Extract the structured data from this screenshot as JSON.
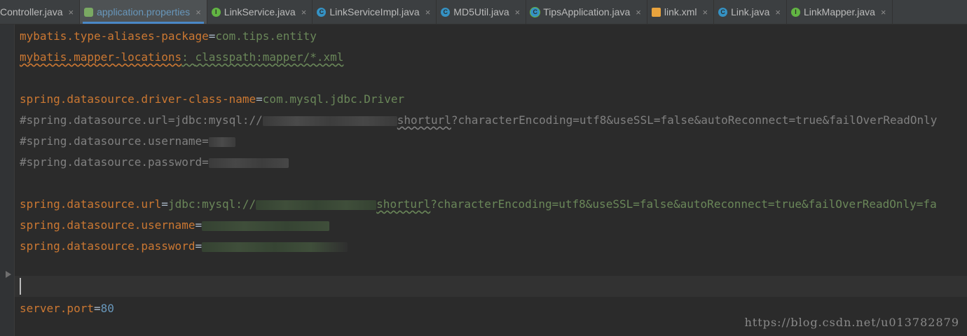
{
  "tabs": [
    {
      "label": "Controller.java",
      "icon": "class-icon",
      "active": false
    },
    {
      "label": "application.properties",
      "icon": "properties-icon",
      "active": true
    },
    {
      "label": "LinkService.java",
      "icon": "interface-icon",
      "active": false
    },
    {
      "label": "LinkServiceImpl.java",
      "icon": "class-icon",
      "active": false
    },
    {
      "label": "MD5Util.java",
      "icon": "class-icon",
      "active": false
    },
    {
      "label": "TipsApplication.java",
      "icon": "spring-app-icon",
      "active": false
    },
    {
      "label": "link.xml",
      "icon": "xml-icon",
      "active": false
    },
    {
      "label": "Link.java",
      "icon": "class-icon",
      "active": false
    },
    {
      "label": "LinkMapper.java",
      "icon": "interface-icon",
      "active": false
    }
  ],
  "close_glyph": "×",
  "code": {
    "l1": {
      "key": "mybatis.type-aliases-package",
      "sep": "=",
      "val": "com.tips.entity"
    },
    "l2": {
      "key": "mybatis.mapper-locations",
      "sep": ": ",
      "val": "classpath:mapper/*.xml"
    },
    "l4": {
      "key": "spring.datasource.driver-class-name",
      "sep": "=",
      "val": "com.mysql.jdbc.Driver"
    },
    "l5": {
      "pre": "#spring.datasource.url=jdbc:mysql://",
      "post_u": "shorturl",
      "post": "?characterEncoding=utf8&useSSL=false&autoReconnect=true&failOverReadOnly"
    },
    "l6": {
      "text": "#spring.datasource.username="
    },
    "l7": {
      "text": "#spring.datasource.password="
    },
    "l9": {
      "key": "spring.datasource.url",
      "sep": "=",
      "val_pre": "jdbc:mysql://",
      "val_u": "shorturl",
      "val_post": "?characterEncoding=utf8&useSSL=false&autoReconnect=true&failOverReadOnly=fa"
    },
    "l10": {
      "key": "spring.datasource.username",
      "sep": "="
    },
    "l11": {
      "key": "spring.datasource.password",
      "sep": "="
    },
    "l14": {
      "key": "server.port",
      "sep": "=",
      "val": "80"
    }
  },
  "watermark": "https://blog.csdn.net/u013782879",
  "colors": {
    "keyword": "#cc7832",
    "value": "#6a8759",
    "comment": "#808080",
    "active_tab_text": "#6897bb",
    "background": "#2b2b2b"
  }
}
